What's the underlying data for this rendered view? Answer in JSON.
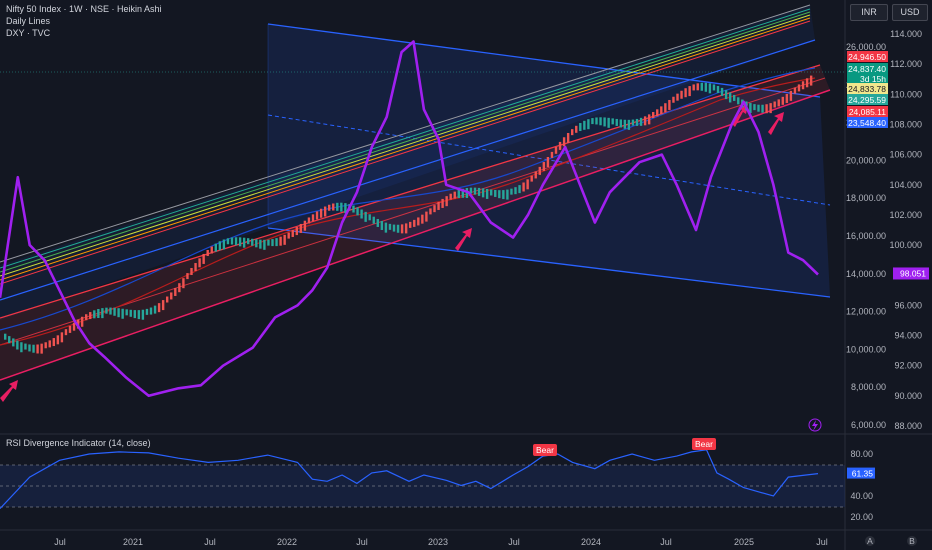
{
  "header": {
    "main_title": "Nifty 50 Index · 1W · NSE · Heikin Ashi",
    "line2": "Daily Lines",
    "line3": "DXY · TVC"
  },
  "currency_buttons": [
    "INR",
    "USD"
  ],
  "rsi_title": "RSI Divergence Indicator (14, close)",
  "bear_labels": [
    "Bear",
    "Bear"
  ],
  "lightning_icon": "lightning-icon",
  "corner_icons": [
    "A",
    "B"
  ],
  "colors": {
    "background": "#131722",
    "dxy_line": "#a020f0",
    "rsi_line": "#2962ff",
    "channel_blue": "#2962ff",
    "red_band": "#f23645",
    "green_band": "#22ab94",
    "bear_label": "#f23645"
  },
  "chart_data": [
    {
      "type": "line",
      "ylim_left_nifty": [
        5200,
        28000
      ],
      "ylim_right_dxy": [
        87,
        115
      ],
      "x_axis_labels": [
        "Jul",
        "2021",
        "Jul",
        "2022",
        "Jul",
        "2023",
        "Jul",
        "2024",
        "Jul",
        "2025",
        "Jul"
      ],
      "y_ticks_left": [
        "26,000.00",
        "24,000.00",
        "22,000.00",
        "20,000.00",
        "18,000.00",
        "16,000.00",
        "14,000.00",
        "12,000.00",
        "10,000.00",
        "8,000.00",
        "6,000.00"
      ],
      "y_ticks_right": [
        "114.000",
        "112.000",
        "110.000",
        "108.000",
        "106.000",
        "104.000",
        "102.000",
        "100.000",
        "98.000",
        "96.000",
        "94.000",
        "92.000",
        "90.000",
        "88.000"
      ],
      "price_labels": [
        {
          "text": "24,946.50",
          "color": "#f23645"
        },
        {
          "text": "24,837.40",
          "color": "#089981"
        },
        {
          "text": "3d 15h",
          "color": "#089981"
        },
        {
          "text": "24,833.78",
          "color": "#f0e68c"
        },
        {
          "text": "24,295.59",
          "color": "#26a69a"
        },
        {
          "text": "24,085.11",
          "color": "#f23645"
        },
        {
          "text": "23,548.40",
          "color": "#2962ff"
        }
      ],
      "dxy_last_label": "98.051",
      "series": [
        {
          "name": "DXY · TVC",
          "x": [
            2020.0,
            2020.12,
            2020.2,
            2020.3,
            2020.4,
            2020.5,
            2020.6,
            2020.7,
            2020.85,
            2021.0,
            2021.2,
            2021.35,
            2021.5,
            2021.7,
            2021.85,
            2022.0,
            2022.1,
            2022.2,
            2022.3,
            2022.4,
            2022.5,
            2022.6,
            2022.7,
            2022.78,
            2022.85,
            2022.95,
            2023.0,
            2023.15,
            2023.3,
            2023.45,
            2023.55,
            2023.65,
            2023.8,
            2023.9,
            2024.0,
            2024.1,
            2024.2,
            2024.3,
            2024.45,
            2024.55,
            2024.68,
            2024.78,
            2024.92,
            2025.0,
            2025.1,
            2025.2,
            2025.3,
            2025.4,
            2025.5
          ],
          "values": [
            96.5,
            104.5,
            100.0,
            99.0,
            97.0,
            95.0,
            93.5,
            92.6,
            91.2,
            90.0,
            90.5,
            90.7,
            92.0,
            93.2,
            95.2,
            96.0,
            97.0,
            98.5,
            101.5,
            103.5,
            106.5,
            108.5,
            112.8,
            113.5,
            109.0,
            107.0,
            104.0,
            103.5,
            101.5,
            100.5,
            102.0,
            104.0,
            106.5,
            104.0,
            101.5,
            103.5,
            104.5,
            105.5,
            106.0,
            104.0,
            101.0,
            104.5,
            108.0,
            109.5,
            107.5,
            104.0,
            99.5,
            99.0,
            98.05
          ],
          "axis": "right"
        },
        {
          "name": "RSI",
          "x": [
            2020.0,
            2020.2,
            2020.4,
            2020.6,
            2020.8,
            2021.0,
            2021.2,
            2021.4,
            2021.6,
            2021.8,
            2022.0,
            2022.1,
            2022.2,
            2022.3,
            2022.4,
            2022.5,
            2022.6,
            2022.75,
            2022.85,
            2023.0,
            2023.1,
            2023.2,
            2023.3,
            2023.45,
            2023.55,
            2023.65,
            2023.75,
            2023.85,
            2024.0,
            2024.1,
            2024.25,
            2024.4,
            2024.55,
            2024.65,
            2024.75,
            2024.82,
            2024.9,
            2025.0,
            2025.1,
            2025.2,
            2025.3,
            2025.42,
            2025.5
          ],
          "values": [
            28,
            58,
            74,
            80,
            82,
            81,
            76,
            72,
            74,
            79,
            72,
            56,
            54,
            60,
            52,
            62,
            64,
            54,
            60,
            55,
            50,
            54,
            47,
            60,
            68,
            78,
            80,
            72,
            66,
            74,
            80,
            74,
            78,
            82,
            84,
            62,
            56,
            48,
            44,
            40,
            58,
            60,
            61.35
          ],
          "axis": "rsi"
        }
      ],
      "rsi_ylim": [
        15,
        95
      ],
      "rsi_ticks": [
        "80.00",
        "61.35",
        "40.00",
        "20.00"
      ],
      "rsi_last": "61.35"
    }
  ]
}
